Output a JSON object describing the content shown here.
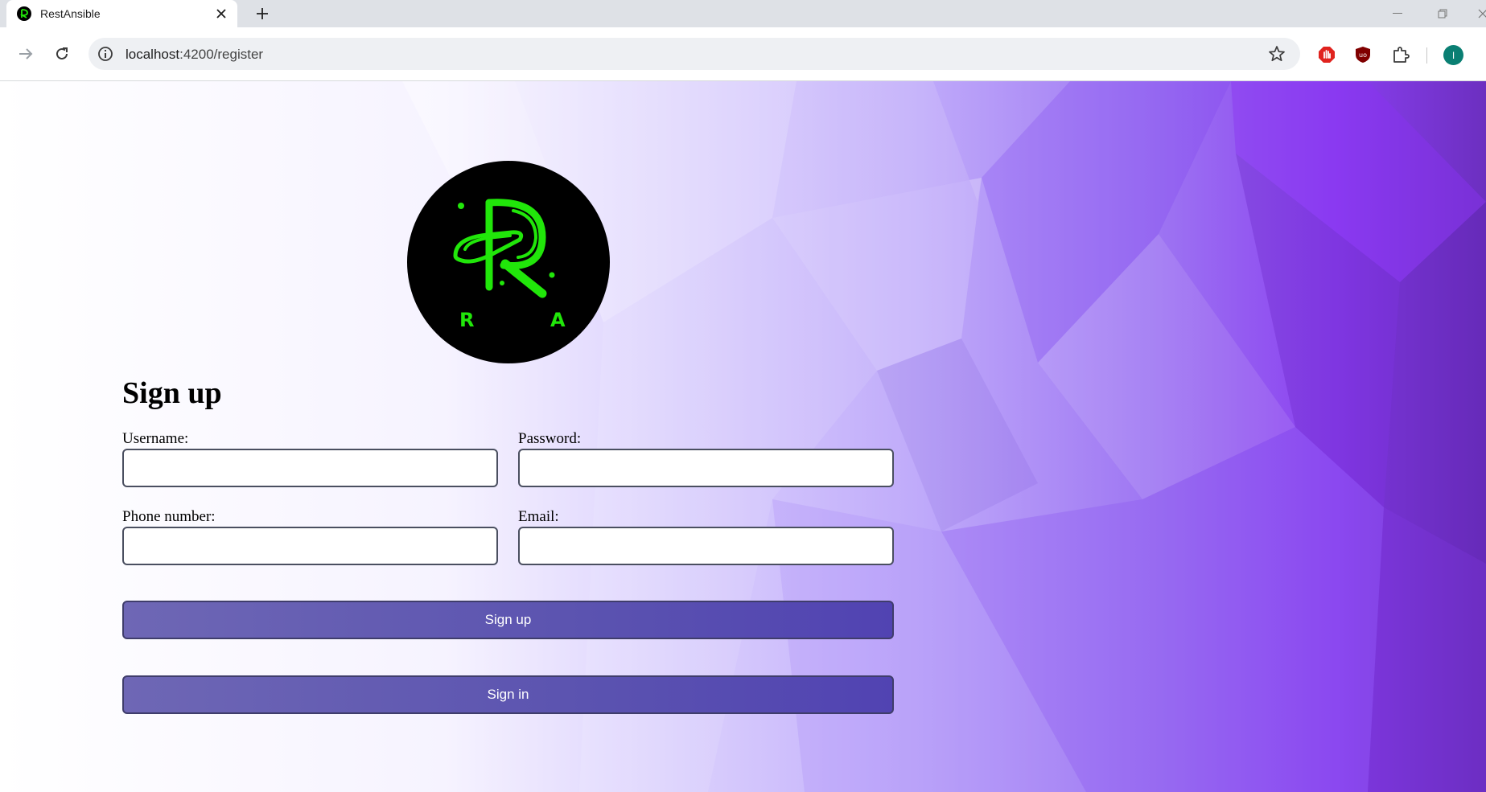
{
  "browser": {
    "tab_title": "RestAnsible",
    "url_host": "localhost",
    "url_rest": ":4200/register",
    "profile_initial": "I"
  },
  "logo": {
    "letter_left": "R",
    "letter_right": "A",
    "colors": {
      "circle": "#000000",
      "mark": "#21e60a"
    }
  },
  "form": {
    "title": "Sign up",
    "fields": [
      {
        "label": "Username:",
        "value": ""
      },
      {
        "label": "Password:",
        "value": ""
      },
      {
        "label": "Phone number:",
        "value": ""
      },
      {
        "label": "Email:",
        "value": ""
      }
    ],
    "primary_button": "Sign up",
    "secondary_button": "Sign in"
  },
  "theme": {
    "accent": "#5b53b0",
    "background_gradient": [
      "#ffffff",
      "#c8b8fb",
      "#8e44f0",
      "#6a2cc0"
    ]
  }
}
